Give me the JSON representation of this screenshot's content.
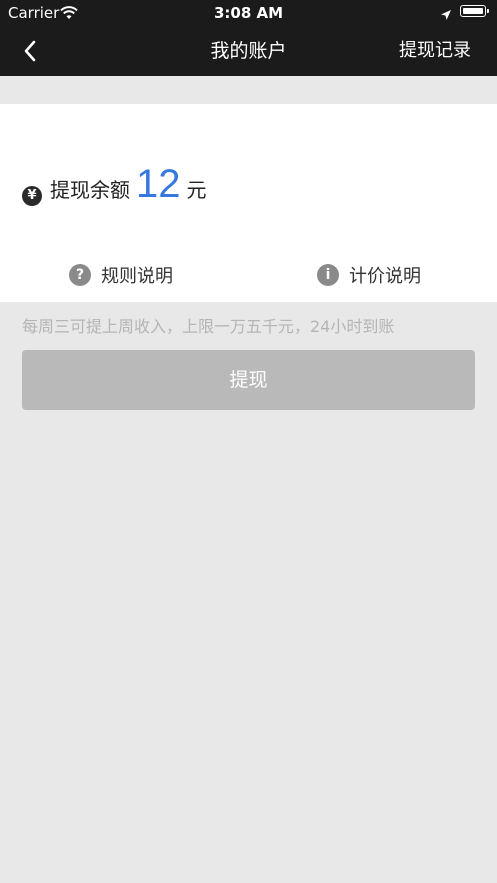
{
  "status_bar": {
    "carrier": "Carrier",
    "time": "3:08 AM"
  },
  "nav": {
    "title": "我的账户",
    "right_action": "提现记录"
  },
  "balance": {
    "label": "提现余额",
    "amount": "12",
    "unit": "元",
    "icon": "yen-icon",
    "icon_glyph": "¥",
    "amount_color": "#3478e0"
  },
  "links": [
    {
      "label": "规则说明",
      "icon": "question-icon",
      "glyph": "?"
    },
    {
      "label": "计价说明",
      "icon": "info-icon",
      "glyph": "i"
    }
  ],
  "hint": "每周三可提上周收入，上限一万五千元，24小时到账",
  "withdraw_button": {
    "label": "提现",
    "color": "#b9b9b9"
  }
}
